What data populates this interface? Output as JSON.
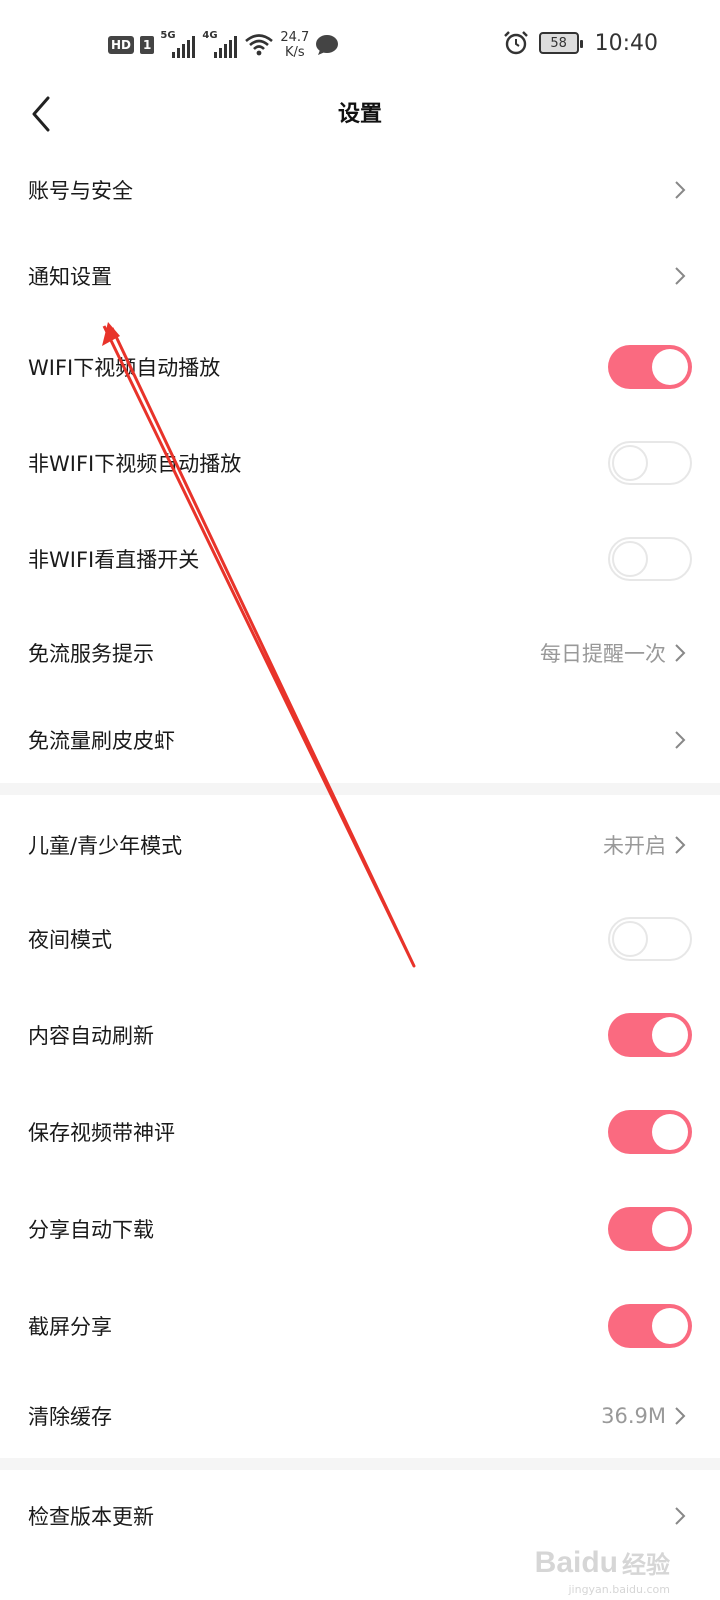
{
  "status_bar": {
    "hd": "HD",
    "sim": "1",
    "net1": "5G",
    "net2": "4G",
    "speed_value": "24.7",
    "speed_unit": "K/s",
    "battery": "58",
    "time": "10:40"
  },
  "header": {
    "title": "设置"
  },
  "settings": {
    "account": {
      "label": "账号与安全"
    },
    "notify": {
      "label": "通知设置"
    },
    "wifi_autoplay": {
      "label": "WIFI下视频自动播放",
      "on": true
    },
    "nonwifi_autoplay": {
      "label": "非WIFI下视频自动播放",
      "on": false
    },
    "nonwifi_live": {
      "label": "非WIFI看直播开关",
      "on": false
    },
    "free_tip": {
      "label": "免流服务提示",
      "value": "每日提醒一次"
    },
    "free_flow": {
      "label": "免流量刷皮皮虾"
    },
    "kids_mode": {
      "label": "儿童/青少年模式",
      "value": "未开启"
    },
    "night_mode": {
      "label": "夜间模式",
      "on": false
    },
    "auto_refresh": {
      "label": "内容自动刷新",
      "on": true
    },
    "save_comment": {
      "label": "保存视频带神评",
      "on": true
    },
    "share_download": {
      "label": "分享自动下载",
      "on": true
    },
    "screenshot_share": {
      "label": "截屏分享",
      "on": true
    },
    "clear_cache": {
      "label": "清除缓存",
      "value": "36.9M"
    },
    "check_update": {
      "label": "检查版本更新"
    }
  },
  "colors": {
    "toggle_on": "#fa6a80",
    "toggle_off_border": "#e7e7e7",
    "annotation_arrow": "#e8332a"
  },
  "watermark": {
    "logo": "Baidu",
    "cn": "经验",
    "url": "jingyan.baidu.com"
  }
}
